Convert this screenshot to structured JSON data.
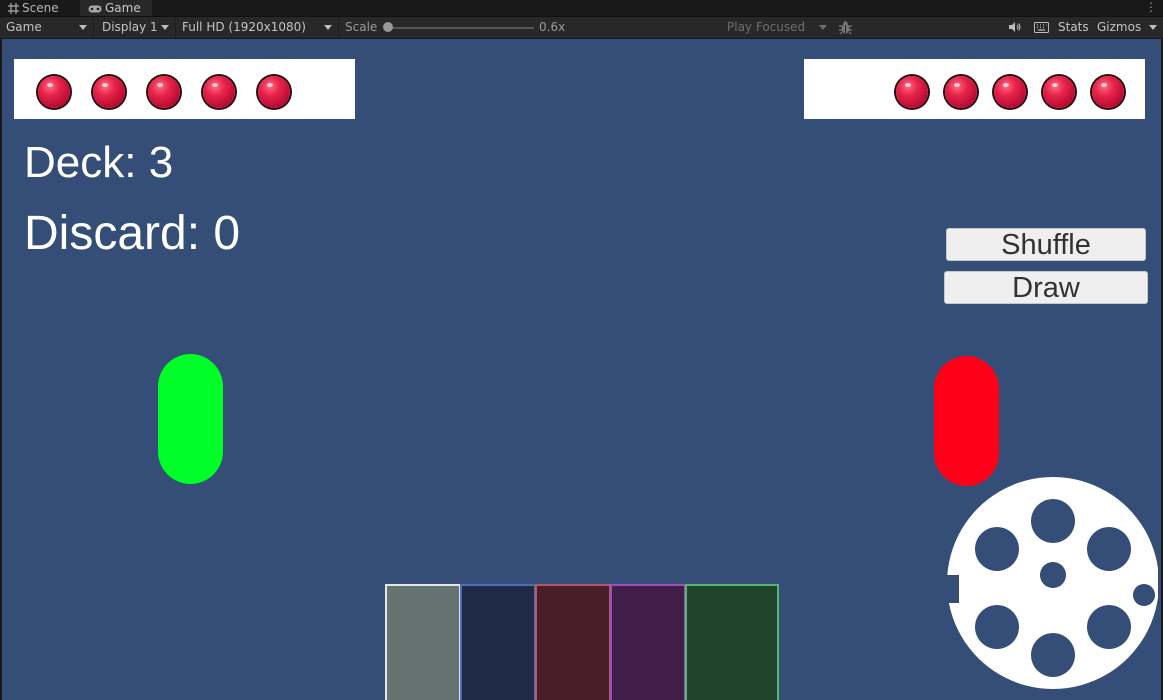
{
  "editor": {
    "tabs": [
      {
        "label": "Scene",
        "icon": "grid-icon"
      },
      {
        "label": "Game",
        "icon": "gamepad-icon"
      }
    ],
    "toolbar": {
      "view_mode": "Game",
      "display": "Display 1",
      "resolution": "Full HD (1920x1080)",
      "scale_label": "Scale",
      "scale_value": "0.6x",
      "scale_fraction": 0.0,
      "play_mode": "Play Focused",
      "stats_label": "Stats",
      "gizmos_label": "Gizmos"
    }
  },
  "game": {
    "background_color": "#344e77",
    "player_lives": 5,
    "opponent_lives": 5,
    "deck_label": "Deck: 3",
    "discard_label": "Discard: 0",
    "buttons": {
      "shuffle": "Shuffle",
      "draw": "Draw"
    },
    "player_color": "#00ff28",
    "opponent_color": "#ff0019",
    "cards": [
      {
        "fill": "#647370",
        "border": "#e6e6e6"
      },
      {
        "fill": "#1e2a47",
        "border": "#4d6fb0"
      },
      {
        "fill": "#4a1e29",
        "border": "#b35a6a"
      },
      {
        "fill": "#411d4a",
        "border": "#a050b4"
      },
      {
        "fill": "#1e4529",
        "border": "#5ab36e"
      }
    ]
  }
}
